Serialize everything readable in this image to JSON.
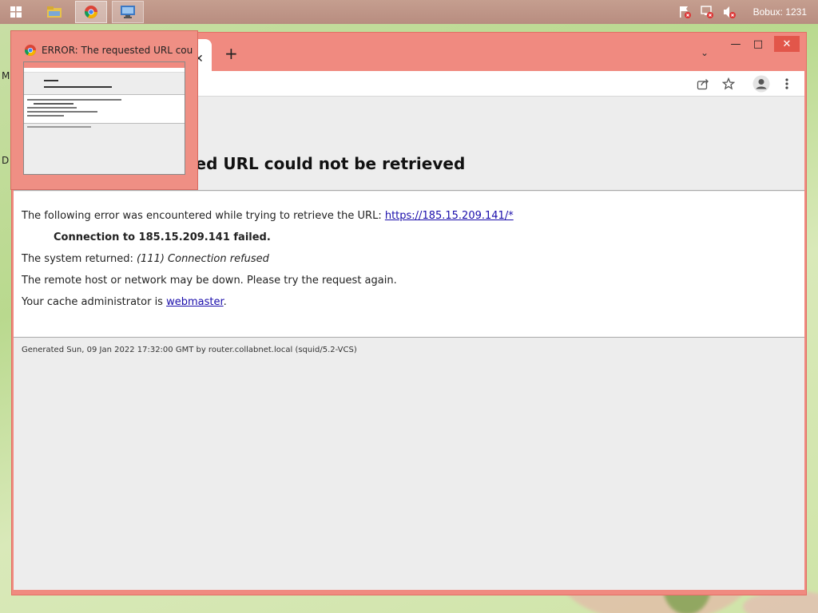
{
  "taskbar": {
    "start_icon": "windows-logo-icon",
    "apps": [
      {
        "name": "file-explorer-icon"
      },
      {
        "name": "chrome-icon"
      },
      {
        "name": "remote-desktop-icon"
      }
    ],
    "tray": {
      "icons": [
        "flag-alert-icon",
        "network-alert-icon",
        "volume-muted-icon"
      ],
      "balance_text": "Bobux: 1231"
    }
  },
  "preview": {
    "title": "ERROR: The requested URL coul..."
  },
  "browser": {
    "tab": {
      "close_glyph": "✕"
    },
    "new_tab_glyph": "+",
    "tab_menu_glyph": "⌄",
    "controls": {
      "minimize": "—",
      "maximize": "□",
      "close": "✕"
    },
    "toolbar_icons": [
      "share-icon",
      "bookmark-star-icon",
      "profile-icon",
      "more-menu-icon"
    ]
  },
  "page": {
    "title": "ERROR: The requested URL could not be retrieved",
    "title_visible": "ted URL could not be retrieved",
    "lines": {
      "following_prefix": "The following error was encountered while trying to retrieve the URL: ",
      "url": "https://185.15.209.141/*",
      "connection": "Connection to 185.15.209.141 failed.",
      "system_prefix": "The system returned: ",
      "system_value": "(111) Connection refused",
      "remote": "The remote host or network may be down. Please try the request again.",
      "cache_prefix": "Your cache administrator is ",
      "cache_link": "webmaster",
      "cache_suffix": "."
    },
    "footer": "Generated Sun, 09 Jan 2022 17:32:00 GMT by router.collabnet.local (squid/5.2-VCS)"
  },
  "desktop": {
    "edge_letters": [
      "M",
      "D"
    ]
  },
  "colors": {
    "window_frame": "#f08a80",
    "close_button": "#e2564a",
    "link": "#1a0dab"
  }
}
